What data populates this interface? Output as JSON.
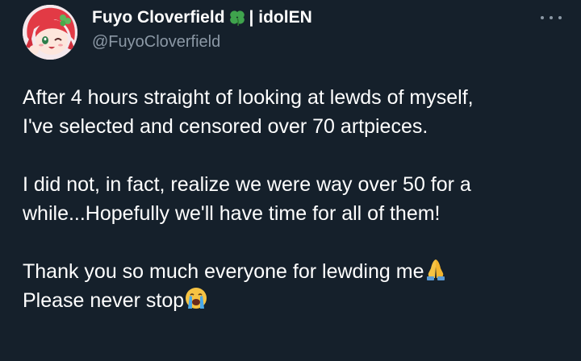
{
  "tweet": {
    "author": {
      "display_name": "Fuyo Cloverfield",
      "name_suffix": "| idolEN",
      "handle": "@FuyoCloverfield",
      "badge_icon": "four-leaf-clover-icon"
    },
    "more_icon": "more-dots-icon",
    "body": {
      "line1": "After 4 hours straight of looking at lewds of myself,",
      "line2": "I've selected and censored over 70 artpieces.",
      "line3": "I did not, in fact, realize we were way over 50 for a",
      "line4": "while...Hopefully we'll have time for all of them!",
      "line5": "Thank you so much everyone for lewding me",
      "line6": "Please never stop",
      "emoji_1": "folded-hands-icon",
      "emoji_2": "loudly-crying-face-icon"
    },
    "colors": {
      "background": "#15202b",
      "text": "#ffffff",
      "secondary_text": "#8b98a5",
      "clover": "#3fa34d"
    }
  }
}
